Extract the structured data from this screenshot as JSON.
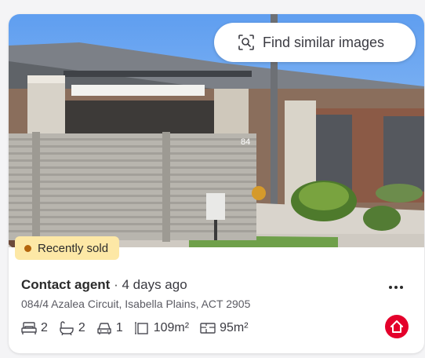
{
  "search_images": {
    "label": "Find similar images",
    "icon": "image-search-icon"
  },
  "status_badge": {
    "label": "Recently sold",
    "dot_color": "#b4650c",
    "background": "#fde8a6"
  },
  "listing": {
    "price": "Contact agent",
    "separator": "·",
    "listed": "4 days ago",
    "address": "084/4 Azalea Circuit, Isabella Plains, ACT 2905"
  },
  "features": {
    "bedrooms": {
      "value": "2",
      "icon": "bed-icon"
    },
    "bathrooms": {
      "value": "2",
      "icon": "bath-icon"
    },
    "car_spaces": {
      "value": "1",
      "icon": "car-icon"
    },
    "land_size": {
      "value": "109m²",
      "icon": "land-size-icon"
    },
    "floor_size": {
      "value": "95m²",
      "icon": "floor-plan-icon"
    }
  },
  "photo": {
    "house_number": "84"
  },
  "brand": {
    "icon": "home-logo-icon",
    "color": "#e4002b"
  }
}
